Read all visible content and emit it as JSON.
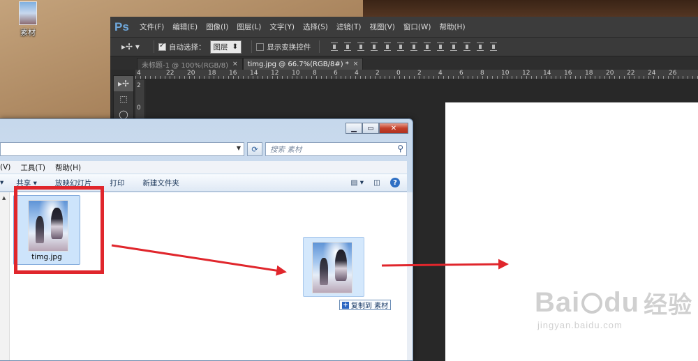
{
  "desktop": {
    "icon_label": "素材"
  },
  "photoshop": {
    "logo": "Ps",
    "menu": [
      "文件(F)",
      "编辑(E)",
      "图像(I)",
      "图层(L)",
      "文字(Y)",
      "选择(S)",
      "滤镜(T)",
      "视图(V)",
      "窗口(W)",
      "帮助(H)"
    ],
    "options": {
      "auto_select_label": "自动选择：",
      "auto_select_value": "图层",
      "show_transform_label": "显示变换控件"
    },
    "tabs": [
      {
        "label": "未标题-1 @ 100%(RGB/8)",
        "close": "×"
      },
      {
        "label": "timg.jpg @ 66.7%(RGB/8#) *",
        "close": "×"
      }
    ],
    "ruler_h": [
      "4",
      "22",
      "20",
      "18",
      "16",
      "14",
      "12",
      "10",
      "8",
      "6",
      "4",
      "2",
      "0",
      "2",
      "4",
      "6",
      "8",
      "10",
      "12",
      "14",
      "16",
      "18",
      "20",
      "22",
      "24",
      "26"
    ],
    "ruler_v": [
      "2",
      "0"
    ]
  },
  "explorer": {
    "search_placeholder": "搜索 素材",
    "menu": [
      "(V)",
      "工具(T)",
      "帮助(H)"
    ],
    "commands": [
      "共享 ▾",
      "放映幻灯片",
      "打印",
      "新建文件夹"
    ],
    "file_name": "timg.jpg",
    "copy_tooltip": "复制到 素材"
  },
  "watermark": {
    "brand": "Bai",
    "brand2": "du",
    "cn": "经验",
    "url": "jingyan.baidu.com"
  },
  "colors": {
    "annotation_red": "#e0262c",
    "ps_bg": "#2b2b2b"
  }
}
